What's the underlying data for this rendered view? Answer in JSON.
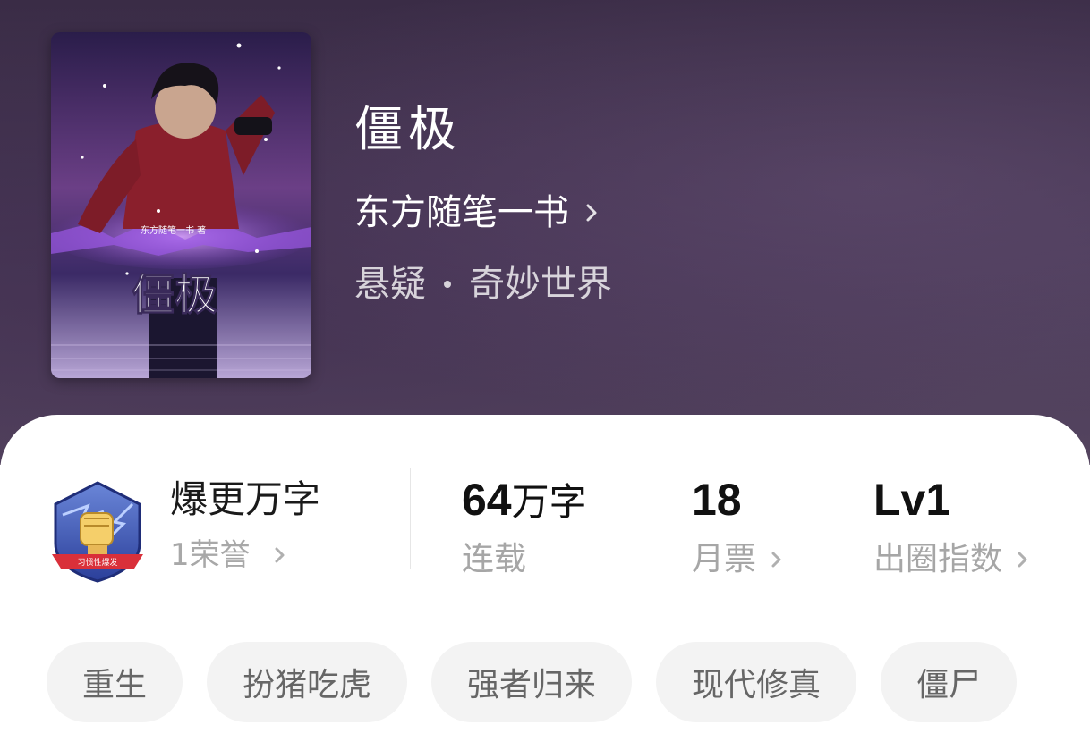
{
  "book": {
    "title": "僵极",
    "author": "东方随笔一书",
    "genre": "悬疑",
    "subgenre": "奇妙世界",
    "cover": {
      "title": "僵极",
      "byline": "东方随笔一书 著"
    }
  },
  "honor": {
    "title": "爆更万字",
    "count_label": "1荣誉",
    "badge_ribbon": "习惯性爆发"
  },
  "stats": {
    "word_count": "64",
    "word_unit": "万字",
    "status_label": "连载",
    "monthly_votes": "18",
    "monthly_votes_label": "月票",
    "level": "Lv1",
    "level_label": "出圈指数"
  },
  "tags": [
    "重生",
    "扮猪吃虎",
    "强者归来",
    "现代修真",
    "僵尸"
  ],
  "icons": {
    "author_chevron": "chevron-right-icon",
    "badge": "fist-lightning-badge-icon"
  },
  "colors": {
    "hero_bg": "#3a2c46",
    "card_bg": "#ffffff",
    "tag_bg": "#f3f3f3",
    "secondary_text": "#a6a6a6"
  }
}
